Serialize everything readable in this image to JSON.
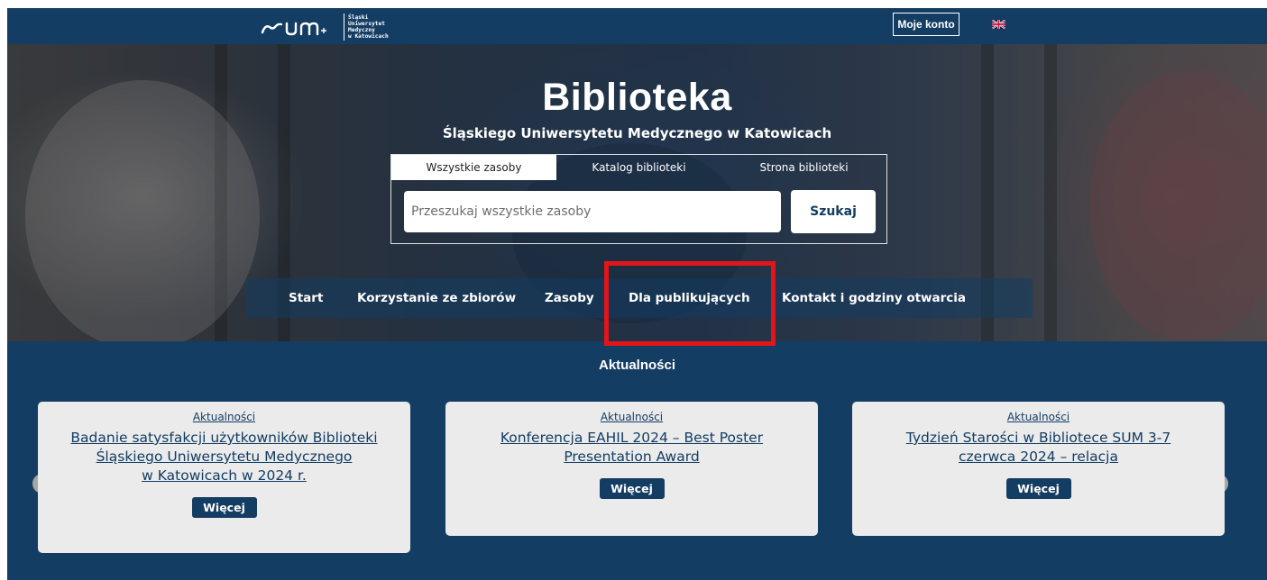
{
  "header": {
    "logo_mark": "sum",
    "logo_lines": [
      "Śląski",
      "Uniwersytet",
      "Medyczny",
      "w Katowicach"
    ],
    "account_label": "Moje konto",
    "language_icon": "uk-flag-icon"
  },
  "hero": {
    "title": "Biblioteka",
    "subtitle": "Śląskiego Uniwersytetu Medycznego w Katowicach",
    "tabs": [
      {
        "label": "Wszystkie zasoby",
        "active": true
      },
      {
        "label": "Katalog biblioteki",
        "active": false
      },
      {
        "label": "Strona biblioteki",
        "active": false
      }
    ],
    "search_placeholder": "Przeszukaj wszystkie zasoby",
    "search_button": "Szukaj"
  },
  "nav": {
    "items": [
      {
        "label": "Start"
      },
      {
        "label": "Korzystanie ze zbiorów"
      },
      {
        "label": "Zasoby"
      },
      {
        "label": "Dla publikujących"
      },
      {
        "label": "Kontakt i godziny otwarcia"
      }
    ]
  },
  "news": {
    "title": "Aktualności",
    "cards": [
      {
        "category": "Aktualności",
        "title_lines": [
          "Badanie satysfakcji użytkowników Biblioteki",
          "Śląskiego Uniwersytetu Medycznego",
          "w Katowicach w 2024 r."
        ],
        "button": "Więcej"
      },
      {
        "category": "Aktualności",
        "title_lines": [
          "Konferencja EAHIL 2024 – Best Poster",
          "Presentation Award"
        ],
        "button": "Więcej"
      },
      {
        "category": "Aktualności",
        "title_lines": [
          "Tydzień Starości w Bibliotece SUM 3-7",
          "czerwca 2024 – relacja"
        ],
        "button": "Więcej"
      }
    ],
    "prev_icon": "chevron-left-icon",
    "next_icon": "chevron-right-icon"
  },
  "colors": {
    "navy": "#133d63",
    "highlight": "#e3151a",
    "card_bg": "#ebebeb"
  }
}
